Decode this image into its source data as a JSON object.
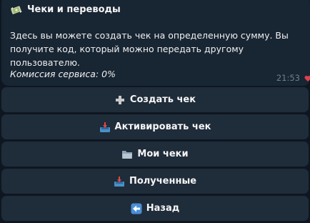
{
  "message": {
    "title": "Чеки и переводы",
    "title_icon": "money-with-wings-icon",
    "body": "Здесь вы можете создать чек на определенную сумму. Вы получите код, который можно передать другому пользователю.",
    "commission": "Комиссия сервиса: 0%",
    "time": "21:53"
  },
  "keyboard": {
    "buttons": [
      {
        "label": "Создать чек",
        "icon": "plus-icon"
      },
      {
        "label": "Активировать чек",
        "icon": "inbox-tray-icon"
      },
      {
        "label": "Мои чеки",
        "icon": "folder-icon"
      },
      {
        "label": "Полученные",
        "icon": "inbox-tray-icon"
      },
      {
        "label": "Назад",
        "icon": "back-arrow-icon"
      }
    ]
  },
  "colors": {
    "background": "#0e1621",
    "bubble": "#182533",
    "button": "#1f2c3a",
    "time": "#6d7f8f"
  }
}
